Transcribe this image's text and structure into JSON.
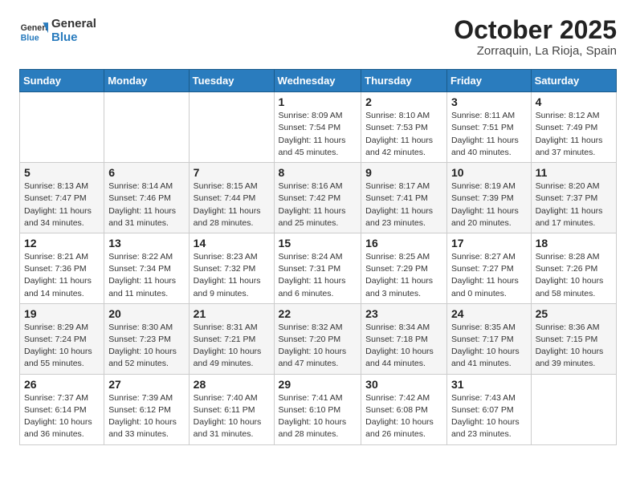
{
  "logo": {
    "line1": "General",
    "line2": "Blue"
  },
  "title": "October 2025",
  "subtitle": "Zorraquin, La Rioja, Spain",
  "days_of_week": [
    "Sunday",
    "Monday",
    "Tuesday",
    "Wednesday",
    "Thursday",
    "Friday",
    "Saturday"
  ],
  "weeks": [
    [
      {
        "day": "",
        "info": ""
      },
      {
        "day": "",
        "info": ""
      },
      {
        "day": "",
        "info": ""
      },
      {
        "day": "1",
        "info": "Sunrise: 8:09 AM\nSunset: 7:54 PM\nDaylight: 11 hours and 45 minutes."
      },
      {
        "day": "2",
        "info": "Sunrise: 8:10 AM\nSunset: 7:53 PM\nDaylight: 11 hours and 42 minutes."
      },
      {
        "day": "3",
        "info": "Sunrise: 8:11 AM\nSunset: 7:51 PM\nDaylight: 11 hours and 40 minutes."
      },
      {
        "day": "4",
        "info": "Sunrise: 8:12 AM\nSunset: 7:49 PM\nDaylight: 11 hours and 37 minutes."
      }
    ],
    [
      {
        "day": "5",
        "info": "Sunrise: 8:13 AM\nSunset: 7:47 PM\nDaylight: 11 hours and 34 minutes."
      },
      {
        "day": "6",
        "info": "Sunrise: 8:14 AM\nSunset: 7:46 PM\nDaylight: 11 hours and 31 minutes."
      },
      {
        "day": "7",
        "info": "Sunrise: 8:15 AM\nSunset: 7:44 PM\nDaylight: 11 hours and 28 minutes."
      },
      {
        "day": "8",
        "info": "Sunrise: 8:16 AM\nSunset: 7:42 PM\nDaylight: 11 hours and 25 minutes."
      },
      {
        "day": "9",
        "info": "Sunrise: 8:17 AM\nSunset: 7:41 PM\nDaylight: 11 hours and 23 minutes."
      },
      {
        "day": "10",
        "info": "Sunrise: 8:19 AM\nSunset: 7:39 PM\nDaylight: 11 hours and 20 minutes."
      },
      {
        "day": "11",
        "info": "Sunrise: 8:20 AM\nSunset: 7:37 PM\nDaylight: 11 hours and 17 minutes."
      }
    ],
    [
      {
        "day": "12",
        "info": "Sunrise: 8:21 AM\nSunset: 7:36 PM\nDaylight: 11 hours and 14 minutes."
      },
      {
        "day": "13",
        "info": "Sunrise: 8:22 AM\nSunset: 7:34 PM\nDaylight: 11 hours and 11 minutes."
      },
      {
        "day": "14",
        "info": "Sunrise: 8:23 AM\nSunset: 7:32 PM\nDaylight: 11 hours and 9 minutes."
      },
      {
        "day": "15",
        "info": "Sunrise: 8:24 AM\nSunset: 7:31 PM\nDaylight: 11 hours and 6 minutes."
      },
      {
        "day": "16",
        "info": "Sunrise: 8:25 AM\nSunset: 7:29 PM\nDaylight: 11 hours and 3 minutes."
      },
      {
        "day": "17",
        "info": "Sunrise: 8:27 AM\nSunset: 7:27 PM\nDaylight: 11 hours and 0 minutes."
      },
      {
        "day": "18",
        "info": "Sunrise: 8:28 AM\nSunset: 7:26 PM\nDaylight: 10 hours and 58 minutes."
      }
    ],
    [
      {
        "day": "19",
        "info": "Sunrise: 8:29 AM\nSunset: 7:24 PM\nDaylight: 10 hours and 55 minutes."
      },
      {
        "day": "20",
        "info": "Sunrise: 8:30 AM\nSunset: 7:23 PM\nDaylight: 10 hours and 52 minutes."
      },
      {
        "day": "21",
        "info": "Sunrise: 8:31 AM\nSunset: 7:21 PM\nDaylight: 10 hours and 49 minutes."
      },
      {
        "day": "22",
        "info": "Sunrise: 8:32 AM\nSunset: 7:20 PM\nDaylight: 10 hours and 47 minutes."
      },
      {
        "day": "23",
        "info": "Sunrise: 8:34 AM\nSunset: 7:18 PM\nDaylight: 10 hours and 44 minutes."
      },
      {
        "day": "24",
        "info": "Sunrise: 8:35 AM\nSunset: 7:17 PM\nDaylight: 10 hours and 41 minutes."
      },
      {
        "day": "25",
        "info": "Sunrise: 8:36 AM\nSunset: 7:15 PM\nDaylight: 10 hours and 39 minutes."
      }
    ],
    [
      {
        "day": "26",
        "info": "Sunrise: 7:37 AM\nSunset: 6:14 PM\nDaylight: 10 hours and 36 minutes."
      },
      {
        "day": "27",
        "info": "Sunrise: 7:39 AM\nSunset: 6:12 PM\nDaylight: 10 hours and 33 minutes."
      },
      {
        "day": "28",
        "info": "Sunrise: 7:40 AM\nSunset: 6:11 PM\nDaylight: 10 hours and 31 minutes."
      },
      {
        "day": "29",
        "info": "Sunrise: 7:41 AM\nSunset: 6:10 PM\nDaylight: 10 hours and 28 minutes."
      },
      {
        "day": "30",
        "info": "Sunrise: 7:42 AM\nSunset: 6:08 PM\nDaylight: 10 hours and 26 minutes."
      },
      {
        "day": "31",
        "info": "Sunrise: 7:43 AM\nSunset: 6:07 PM\nDaylight: 10 hours and 23 minutes."
      },
      {
        "day": "",
        "info": ""
      }
    ]
  ]
}
